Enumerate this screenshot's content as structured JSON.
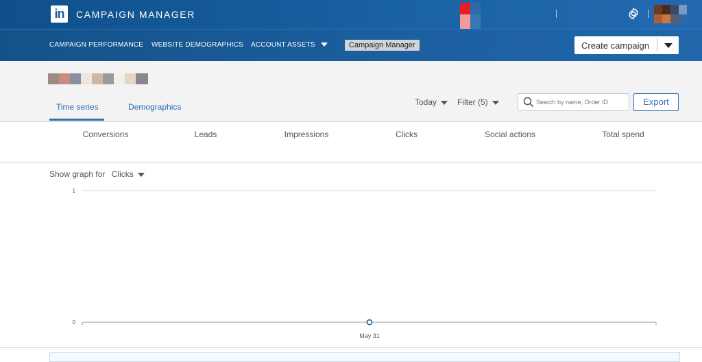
{
  "topbar": {
    "logo_text": "in",
    "brand": "CAMPAIGN MANAGER",
    "icons": {
      "settings": "gear-icon"
    }
  },
  "nav": {
    "items": [
      {
        "label": "CAMPAIGN PERFORMANCE"
      },
      {
        "label": "WEBSITE DEMOGRAPHICS"
      },
      {
        "label": "ACCOUNT ASSETS"
      }
    ],
    "tag": "Campaign Manager",
    "create_label": "Create campaign"
  },
  "tabs": [
    {
      "label": "Time series",
      "active": true
    },
    {
      "label": "Demographics",
      "active": false
    }
  ],
  "controls": {
    "date": "Today",
    "filter": "Filter",
    "filter_count": "(5)",
    "search_placeholder": "Search by name, Order ID",
    "export": "Export"
  },
  "metrics": [
    "Conversions",
    "Leads",
    "Impressions",
    "Clicks",
    "Social actions",
    "Total spend"
  ],
  "graph": {
    "show_for_label": "Show graph for",
    "metric": "Clicks"
  },
  "chart_data": {
    "type": "line",
    "x": [
      "May 31"
    ],
    "series": [
      {
        "values": [
          0
        ]
      }
    ],
    "ylim": [
      0,
      1
    ],
    "yticks": [
      "1",
      "0"
    ],
    "xticks": [
      "May 31"
    ],
    "grid": true,
    "accent": "#1d6090"
  },
  "colors": {
    "header": "#1a5996",
    "accent": "#2f71b4"
  }
}
